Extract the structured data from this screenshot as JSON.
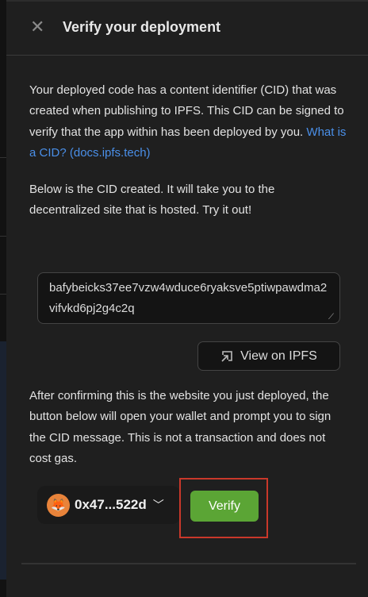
{
  "header": {
    "title": "Verify your deployment",
    "close_icon": "close-icon"
  },
  "intro": {
    "text": "Your deployed code has a content identifier (CID) that was created when publishing to IPFS. This CID can be signed to verify that the app within has been deployed by you. ",
    "link": "What is a CID? (docs.ipfs.tech)"
  },
  "cid_note": "Below is the CID created. It will take you to the decentralized site that is hosted. Try it out!",
  "cid_value": "bafybeicks37ee7vzw4wduce6ryaksve5ptiwpawdma2vifvkd6pj2g4c2q",
  "view_button": {
    "label": "View on IPFS",
    "icon": "external-link-icon"
  },
  "confirm_note": "After confirming this is the website you just deployed, the button below will open your wallet and prompt you to sign the CID message. This is not a transaction and does not cost gas.",
  "wallet": {
    "address": "0x47...522d",
    "icon": "metamask-fox-icon"
  },
  "verify_button": {
    "label": "Verify",
    "color": "#5ba535"
  },
  "highlight_color": "#c9382a"
}
